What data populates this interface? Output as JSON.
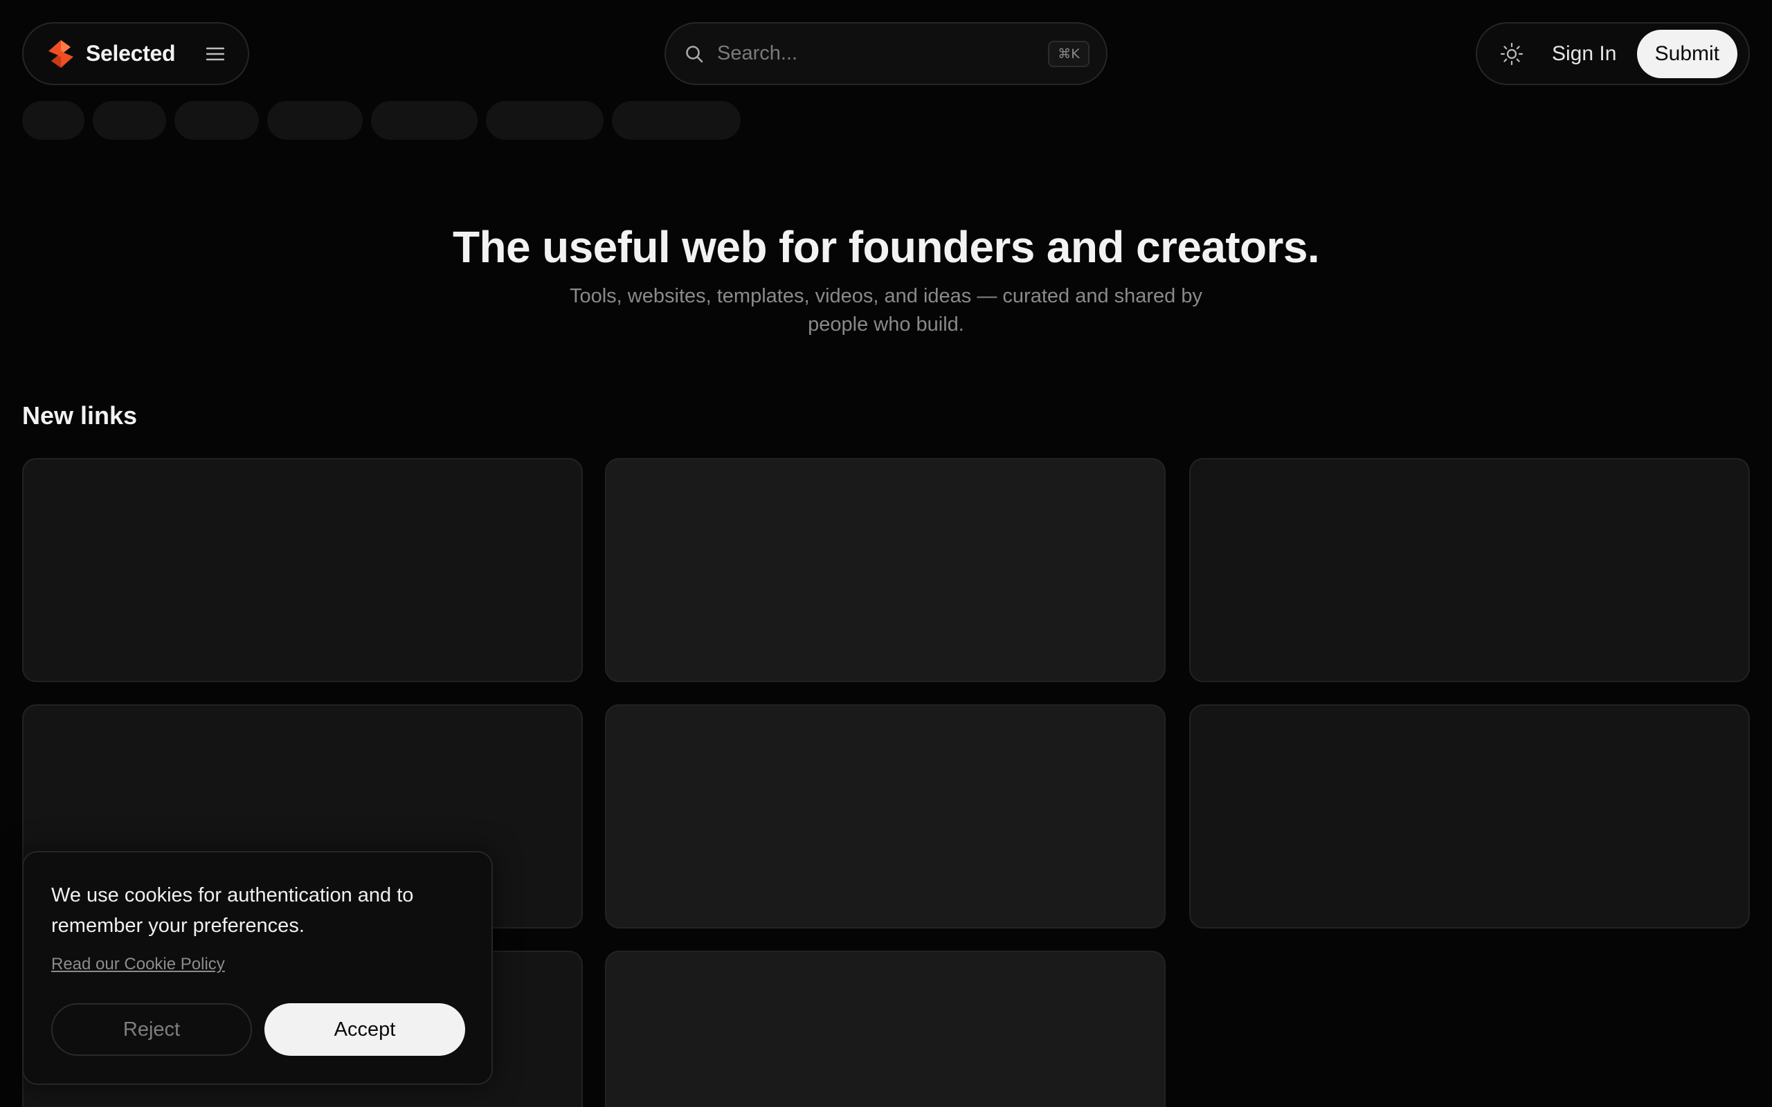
{
  "header": {
    "brand_name": "Selected",
    "brand_color": "#f04e23",
    "menu_icon": "hamburger-menu-icon",
    "search": {
      "placeholder": "Search...",
      "value": "",
      "shortcut": "⌘K"
    },
    "theme_icon": "sun-icon",
    "signin_label": "Sign In",
    "submit_label": "Submit"
  },
  "hero": {
    "title": "The useful web for founders and creators.",
    "subtitle": "Tools, websites, templates, videos, and ideas — curated and shared by people who build."
  },
  "sections": {
    "new_links_title": "New links"
  },
  "cookie_banner": {
    "message": "We use cookies for authentication and to remember your preferences.",
    "policy_link": "Read our Cookie Policy",
    "reject_label": "Reject",
    "accept_label": "Accept"
  }
}
